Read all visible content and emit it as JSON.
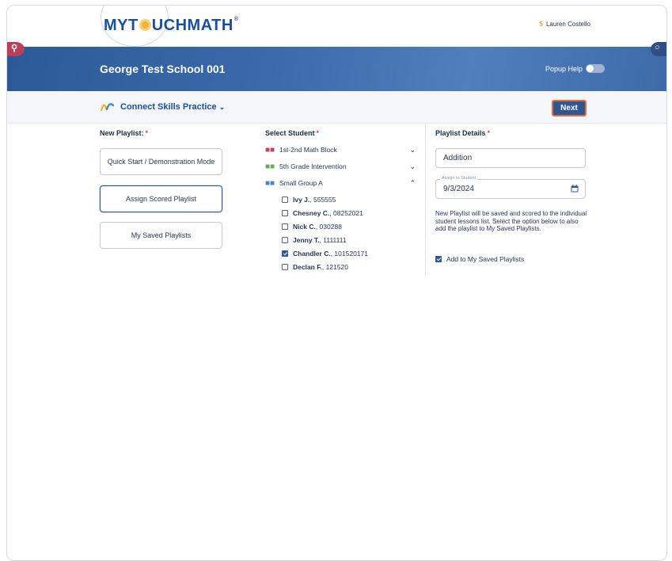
{
  "header": {
    "logo_pre": "MYT",
    "logo_post": "UCHMATH",
    "logo_tm": "®",
    "user_badge": "5",
    "user_name": "Lauren Costello"
  },
  "banner": {
    "school": "George Test School 001",
    "popup_help_label": "Popup Help",
    "popup_help_on": false
  },
  "subheader": {
    "module_title": "Connect Skills Practice",
    "next_label": "Next"
  },
  "new_playlist": {
    "title": "New Playlist:",
    "required_mark": "*",
    "buttons": [
      {
        "label": "Quick Start / Demonstration Mode",
        "active": false
      },
      {
        "label": "Assign Scored Playlist",
        "active": true
      },
      {
        "label": "My Saved Playlists",
        "active": false
      }
    ]
  },
  "select_student": {
    "title": "Select Student",
    "required_mark": "*",
    "groups": [
      {
        "label": "1st-2nd Math Block",
        "color": "#c0435a",
        "expanded": false
      },
      {
        "label": "5th Grade Intervention",
        "color": "#6ca858",
        "expanded": false
      },
      {
        "label": "Small Group A",
        "color": "#4a87c6",
        "expanded": true
      }
    ],
    "students": [
      {
        "name": "Ivy J.",
        "id": ", 555555",
        "checked": false
      },
      {
        "name": "Chesney C.",
        "id": ", 08252021",
        "checked": false
      },
      {
        "name": "Nick C.",
        "id": ", 030288",
        "checked": false
      },
      {
        "name": "Jenny T.",
        "id": ", 1111111",
        "checked": false
      },
      {
        "name": "Chandler C.",
        "id": ", 101520171",
        "checked": true
      },
      {
        "name": "Declan F.",
        "id": ", 121520",
        "checked": false
      }
    ]
  },
  "playlist_details": {
    "title": "Playlist Details",
    "required_mark": "*",
    "name_value": "Addition",
    "assign_label": "Assign to Student",
    "date_value": "9/3/2024",
    "info": "New Playlist will be saved and scored to the individual student lessons list. Select the option below to also add the playlist to My Saved Playlists.",
    "save_option_label": "Add to My Saved Playlists",
    "save_option_checked": true
  },
  "colors": {
    "primary": "#2f5794",
    "accent": "#e56c3b",
    "required": "#e0484b"
  }
}
